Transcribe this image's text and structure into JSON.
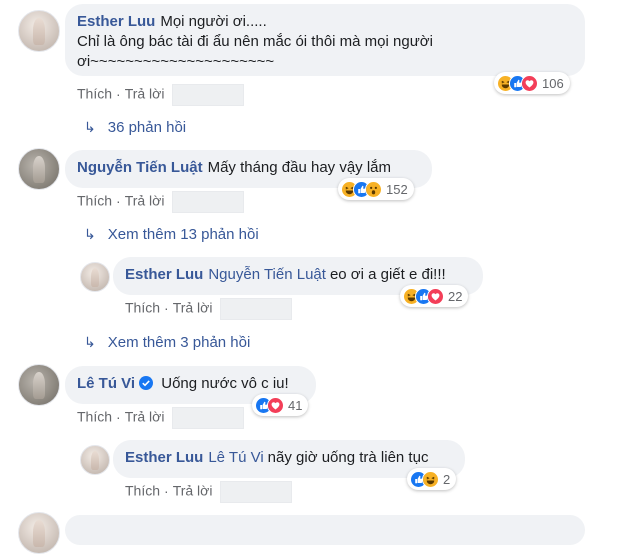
{
  "comments": [
    {
      "author": "Esther Luu",
      "text_line1": "Mọi người ơi.....",
      "text_line2": "Chỉ là ông bác tài đi ẩu nên mắc ói thôi mà mọi người",
      "text_line3": "ơi~~~~~~~~~~~~~~~~~~~~~",
      "reactions": [
        "haha",
        "like",
        "love"
      ],
      "reaction_count": "106",
      "like_label": "Thích",
      "reply_label": "Trả lời",
      "replies_link": "36 phản hồi"
    },
    {
      "author": "Nguyễn Tiến Luật",
      "text": "Mấy tháng đầu hay vậy lắm",
      "reactions": [
        "haha",
        "like",
        "wow"
      ],
      "reaction_count": "152",
      "like_label": "Thích",
      "reply_label": "Trả lời",
      "more_replies": "Xem thêm 13 phản hồi",
      "reply": {
        "author": "Esther Luu",
        "tag": "Nguyễn Tiến Luật",
        "text": "eo ơi a giết e đi!!!",
        "reactions": [
          "haha",
          "like",
          "love"
        ],
        "reaction_count": "22",
        "like_label": "Thích",
        "reply_label": "Trả lời"
      },
      "more_replies_after": "Xem thêm 3 phản hồi"
    },
    {
      "author": "Lê Tú Vi",
      "verified": true,
      "text": "Uống nước vô c iu!",
      "reactions": [
        "like",
        "love"
      ],
      "reaction_count": "41",
      "like_label": "Thích",
      "reply_label": "Trả lời",
      "reply": {
        "author": "Esther Luu",
        "tag": "Lê Tú Vi",
        "text": "nãy giờ uống trà liên tục",
        "reactions": [
          "like",
          "haha"
        ],
        "reaction_count": "2",
        "like_label": "Thích",
        "reply_label": "Trả lời"
      }
    }
  ],
  "colors": {
    "link": "#385898",
    "bubble": "#f0f2f5",
    "meta": "#65676b",
    "like": "#1877f2",
    "love": "#f33e58",
    "haha": "#f7b125"
  }
}
